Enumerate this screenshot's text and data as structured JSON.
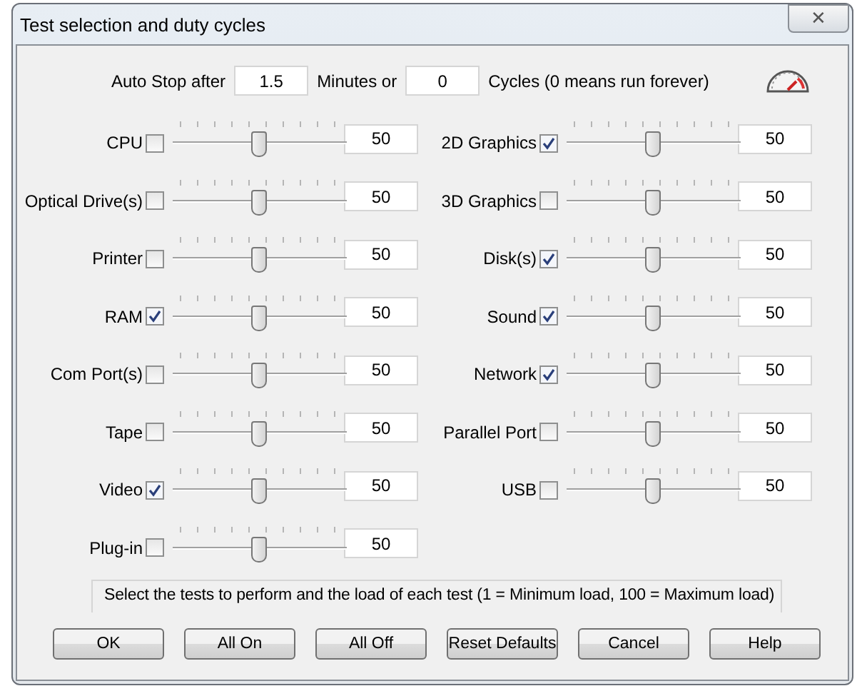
{
  "window": {
    "title": "Test selection and duty cycles",
    "close": "✕"
  },
  "auto_stop": {
    "label": "Auto Stop after",
    "minutes": "1.5",
    "minutes_label": "Minutes or",
    "cycles": "0",
    "cycles_label": "Cycles (0 means run forever)"
  },
  "left_column": [
    {
      "label": "CPU",
      "checked": false,
      "level": 0.5,
      "value": "50"
    },
    {
      "label": "Optical Drive(s)",
      "checked": false,
      "level": 0.5,
      "value": "50"
    },
    {
      "label": "Printer",
      "checked": false,
      "level": 0.5,
      "value": "50"
    },
    {
      "label": "RAM",
      "checked": true,
      "level": 0.5,
      "value": "50"
    },
    {
      "label": "Com Port(s)",
      "checked": false,
      "level": 0.5,
      "value": "50"
    },
    {
      "label": "Tape",
      "checked": false,
      "level": 0.5,
      "value": "50"
    },
    {
      "label": "Video",
      "checked": true,
      "level": 0.5,
      "value": "50"
    },
    {
      "label": "Plug-in",
      "checked": false,
      "level": 0.5,
      "value": "50"
    }
  ],
  "right_column": [
    {
      "label": "2D Graphics",
      "checked": true,
      "level": 0.5,
      "value": "50"
    },
    {
      "label": "3D Graphics",
      "checked": false,
      "level": 0.5,
      "value": "50"
    },
    {
      "label": "Disk(s)",
      "checked": true,
      "level": 0.5,
      "value": "50"
    },
    {
      "label": "Sound",
      "checked": true,
      "level": 0.5,
      "value": "50"
    },
    {
      "label": "Network",
      "checked": true,
      "level": 0.5,
      "value": "50"
    },
    {
      "label": "Parallel Port",
      "checked": false,
      "level": 0.5,
      "value": "50"
    },
    {
      "label": "USB",
      "checked": false,
      "level": 0.5,
      "value": "50"
    }
  ],
  "hint": "Select the tests to perform and the load of each test (1 = Minimum load, 100 = Maximum load)",
  "buttons": [
    "OK",
    "All On",
    "All Off",
    "Reset Defaults",
    "Cancel",
    "Help"
  ]
}
